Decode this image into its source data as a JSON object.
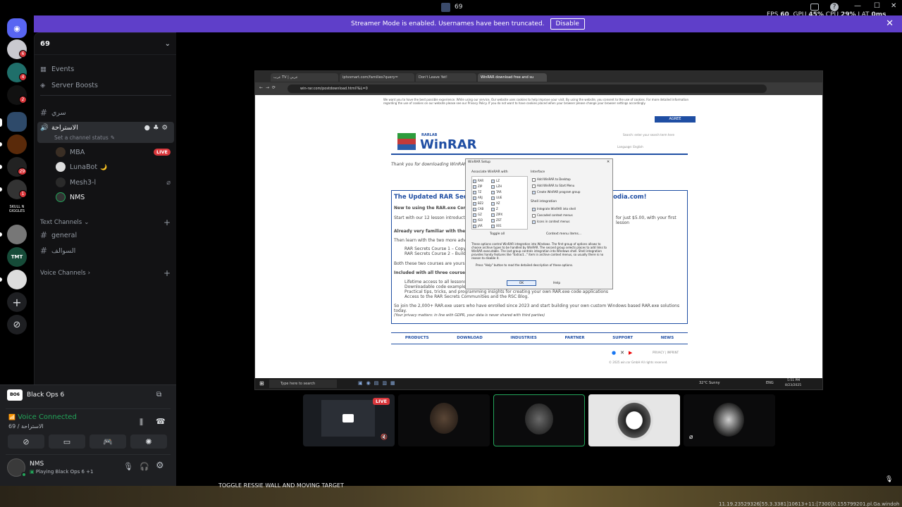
{
  "window": {
    "title": "69",
    "minimize": "—",
    "maximize": "☐",
    "close": "✕"
  },
  "overlay": {
    "fps_label": "FPS",
    "fps": "60",
    "gpu_label": "GPU",
    "gpu": "45%",
    "cpu_label": "CPU",
    "cpu": "29%",
    "lat_label": "LAT",
    "lat": "0ms"
  },
  "banner": {
    "text": "Streamer Mode is enabled. Usernames have been truncated.",
    "button": "Disable"
  },
  "servers": [
    {
      "badge": "6"
    },
    {
      "badge": "4"
    },
    {
      "badge": "2"
    },
    {
      "badge": ""
    },
    {
      "badge": ""
    },
    {
      "badge": "29"
    },
    {
      "badge": "1"
    },
    {
      "badge": ""
    },
    {
      "badge": ""
    },
    {
      "badge": ""
    },
    {
      "badge": ""
    }
  ],
  "server_labels": {
    "skull": "SKULL N GIGGLES",
    "tmt": "TMT"
  },
  "sidebar": {
    "server_name": "69",
    "events": "Events",
    "boosts": "Server Boosts",
    "channel_secret": "سري",
    "voice_channel": "الاستراحة",
    "channel_status": "Set a channel status",
    "members": [
      {
        "name": "MBA",
        "live": "LIVE"
      },
      {
        "name": "LunaBot",
        "emoji": "🌙"
      },
      {
        "name": "Mesh3-l"
      },
      {
        "name": "NMS"
      }
    ],
    "text_channels": "Text Channels",
    "channels": [
      "general",
      "السوالف"
    ],
    "voice_channels": "Voice Channels"
  },
  "activity": {
    "game": "Black Ops 6"
  },
  "voice": {
    "status": "Voice Connected",
    "location": "69 / الاستراحة"
  },
  "user": {
    "name": "NMS",
    "status": "Playing Black Ops 6 +1"
  },
  "stream": {
    "tabs": [
      "عرب TV | عربي",
      "iptvsmart.com/families?query=",
      "Don't Leave Yet!",
      "WinRAR download free and su"
    ],
    "url": "win-rar.com/postdownload.html?&L=0",
    "cookie_text": "We want you to have the best possible experience. While using our service, Our website uses cookies to help improve your visit. By using the website, you consent to the use of cookies. For more detailed information regarding the use of cookies on our website please see our Privacy Policy. If you do not want to have cookies placed when your browser please change your browser settings accordingly.",
    "agree": "AGREE",
    "logo_small": "RARLAB",
    "logo": "WinRAR",
    "search": "Search: enter your search term here",
    "language": "Language: English",
    "thanks": "Thank you for downloading WinRAR. If y",
    "box_title": "The Updated RAR Secre",
    "box_title_end": "podia.com!",
    "new_line": "New to using the RAR.exe Commanc",
    "start_line": "Start with our 12 lesson introductory",
    "price_line": "for just $5.00, with your first lesson",
    "already": "Already very familiar with the RAR.e",
    "then": "Then learn with the two more advancec",
    "course1": "RAR Secrets Course 1 – Copy a",
    "course2": "RAR Secrets Course 2 – Build a",
    "both": "Both these two courses are yours for o",
    "included": "Included with all three courses:",
    "inc1": "Lifetime access to all lessons and",
    "inc2": "Downloadable code examples, a",
    "inc3": "Practical tips, tricks, and programming insights for creating your own RAR.exe code applications",
    "inc4": "Access to the RAR Secrets Communities and the RSC Blog.",
    "join": "So join the 2,000+ RAR.exe users who have enrolled since 2023 and start building your own custom Windows based RAR.exe solutions today.",
    "privacy": "(Your privacy matters: in line with GDPR, your data is never shared with third parties)",
    "nav": [
      "PRODUCTS",
      "DOWNLOAD",
      "INDUSTRIES",
      "PARTNER",
      "SUPPORT",
      "NEWS"
    ],
    "footer_links": "PRIVACY | IMPRINT",
    "copyright": "© 2025 win.rar GmbH All rights reserved.",
    "dialog": {
      "title": "WinRAR Setup",
      "associate": "Associate WinRAR with",
      "interface": "Interface",
      "types_left": [
        "RAR",
        "ZIP",
        "7Z",
        "ARJ",
        "BZ2",
        "CAB",
        "GZ",
        "ISO",
        "JAR"
      ],
      "types_right": [
        "LZ",
        "LZH",
        "TAR",
        "UUE",
        "XZ",
        "Z",
        "ZIPX",
        "ZST",
        "001"
      ],
      "iface": [
        "Add WinRAR to Desktop",
        "Add WinRAR to Start Menu",
        "Create WinRAR program group"
      ],
      "shell": "Shell integration",
      "shell_opts": [
        "Integrate WinRAR into shell",
        "Cascaded context menus",
        "Icons in context menus"
      ],
      "toggle": "Toggle all",
      "context": "Context menu items...",
      "desc": "These options control WinRAR integration into Windows. The first group of options allows to choose archive types to be handled by WinRAR. The second group selects places to add links to WinRAR executable. The last group controls integration into Windows shell. Shell integration provides handy features like \"Extract...\" item in archive context menus, so usually there is no reason to disable it.",
      "help_hint": "Press \"Help\" button to read the detailed description of these options.",
      "ok": "OK",
      "help": "Help"
    },
    "taskbar_search": "Type here to search",
    "weather": "32°C Sunny",
    "lang": "ENG",
    "time": "5:51 PM",
    "date": "8/23/2025"
  },
  "tiles": [
    {
      "live": "LIVE"
    },
    {},
    {},
    {},
    {}
  ],
  "bottom": {
    "text": "TOGGLE RESSIE WALL AND MOVING TARGET",
    "coords": "11.19.23529326[55.3.3381]10613+11:[7300]0.155799201.pl.Ga.windoh"
  }
}
